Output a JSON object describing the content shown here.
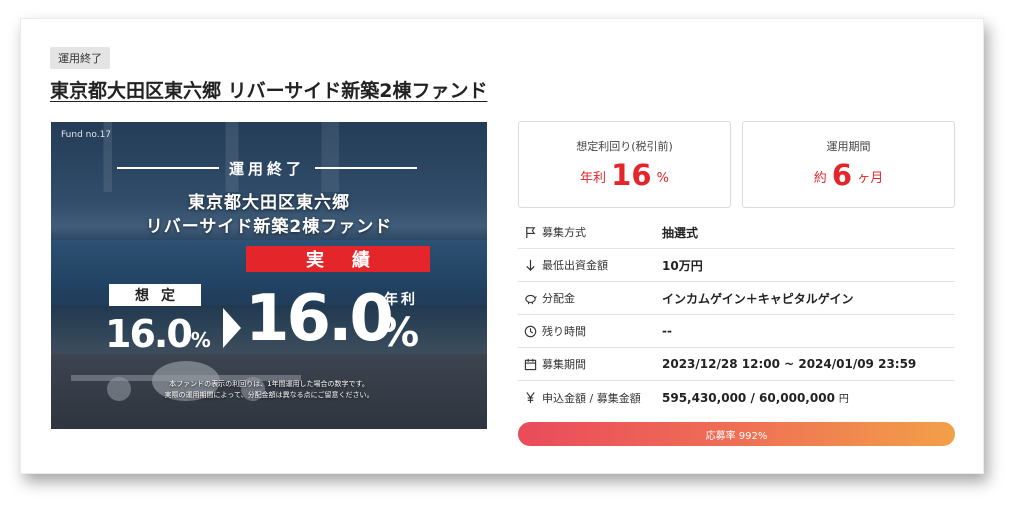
{
  "status_tag": "運用終了",
  "fund_title": "東京都大田区東六郷 リバーサイド新築2棟ファンド",
  "banner": {
    "fund_no": "Fund no.17",
    "ended": "運用終了",
    "title_line1": "東京都大田区東六郷",
    "title_line2": "リバーサイド新築2棟ファンド",
    "actual_label": "実績",
    "expected_label": "想定",
    "annual_label": "年利",
    "expected_value": "16.0",
    "expected_unit": "%",
    "actual_value": "16.0",
    "actual_unit": "%",
    "note_line1": "本ファンドの表示の利回りは、1年間運用した場合の数字です。",
    "note_line2": "実際の運用期間によって、分配金額は異なる点にご留意ください。"
  },
  "yield_box": {
    "label": "想定利回り(税引前)",
    "prefix": "年利",
    "value": "16",
    "suffix": "%"
  },
  "period_box": {
    "label": "運用期間",
    "prefix": "約",
    "value": "6",
    "suffix": "ヶ月"
  },
  "info": [
    {
      "icon": "flag-icon",
      "label": "募集方式",
      "value": "抽選式"
    },
    {
      "icon": "arrow-down-icon",
      "label": "最低出資金額",
      "value": "10万円"
    },
    {
      "icon": "piggy-bank-icon",
      "label": "分配金",
      "value": "インカムゲイン＋キャピタルゲイン"
    },
    {
      "icon": "clock-icon",
      "label": "残り時間",
      "value": "--"
    },
    {
      "icon": "calendar-icon",
      "label": "募集期間",
      "value": "2023/12/28 12:00 ~ 2024/01/09 23:59"
    },
    {
      "icon": "yen-icon",
      "label": "申込金額 / 募集金額",
      "value": "595,430,000 / 60,000,000",
      "unit": "円"
    }
  ],
  "progress": {
    "text": "応募率 992%",
    "percent": 992
  },
  "colors": {
    "accent_red": "#e4262b",
    "progress_start": "#ea4b5b",
    "progress_end": "#f2a048"
  }
}
